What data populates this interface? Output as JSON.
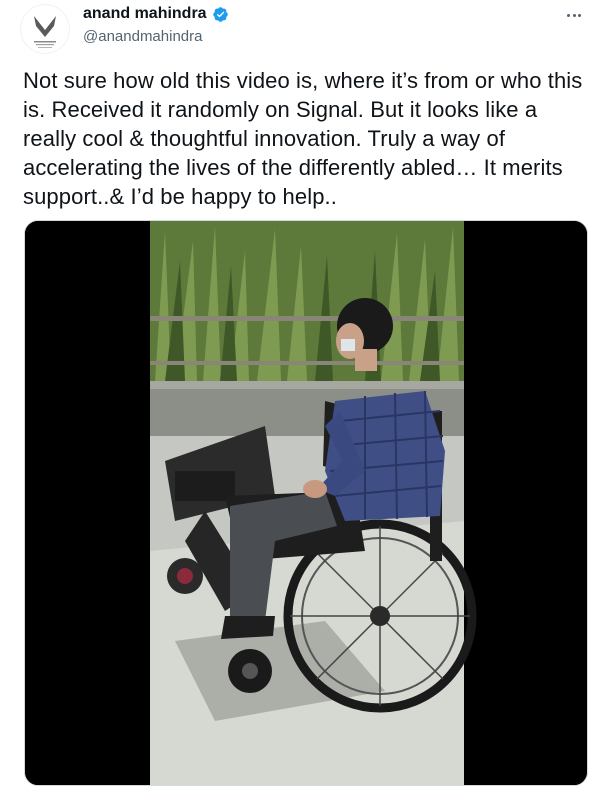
{
  "author": {
    "display_name": "anand mahindra",
    "handle": "@anandmahindra",
    "verified": true,
    "avatar_icon": "mahindra-logo-icon"
  },
  "menu_icon": "more-horizontal-icon",
  "tweet": {
    "text": "Not sure how old this video is, where it’s from or who this is. Received it randomly on Signal. But it looks like a really cool & thoughtful innovation. Truly a way of accelerating the lives of the differently abled… It merits support..& I’d be happy to help.."
  },
  "media": {
    "type": "video",
    "icon": "video-frame"
  },
  "colors": {
    "text": "#0f1419",
    "secondary": "#536471",
    "verified": "#1d9bf0",
    "media_background": "#000000"
  }
}
